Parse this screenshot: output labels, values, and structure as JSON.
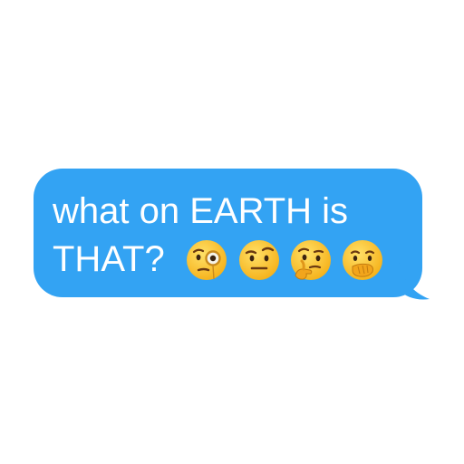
{
  "message": {
    "line1": "what on EARTH is",
    "line2": "THAT?"
  },
  "emojis": [
    {
      "name": "face-with-monocle-icon"
    },
    {
      "name": "face-with-raised-eyebrow-icon"
    },
    {
      "name": "thinking-face-icon"
    },
    {
      "name": "face-with-hand-over-mouth-icon"
    }
  ],
  "colors": {
    "bubble": "#33a3f3",
    "text": "#ffffff",
    "emoji_face": "#ffc933"
  }
}
